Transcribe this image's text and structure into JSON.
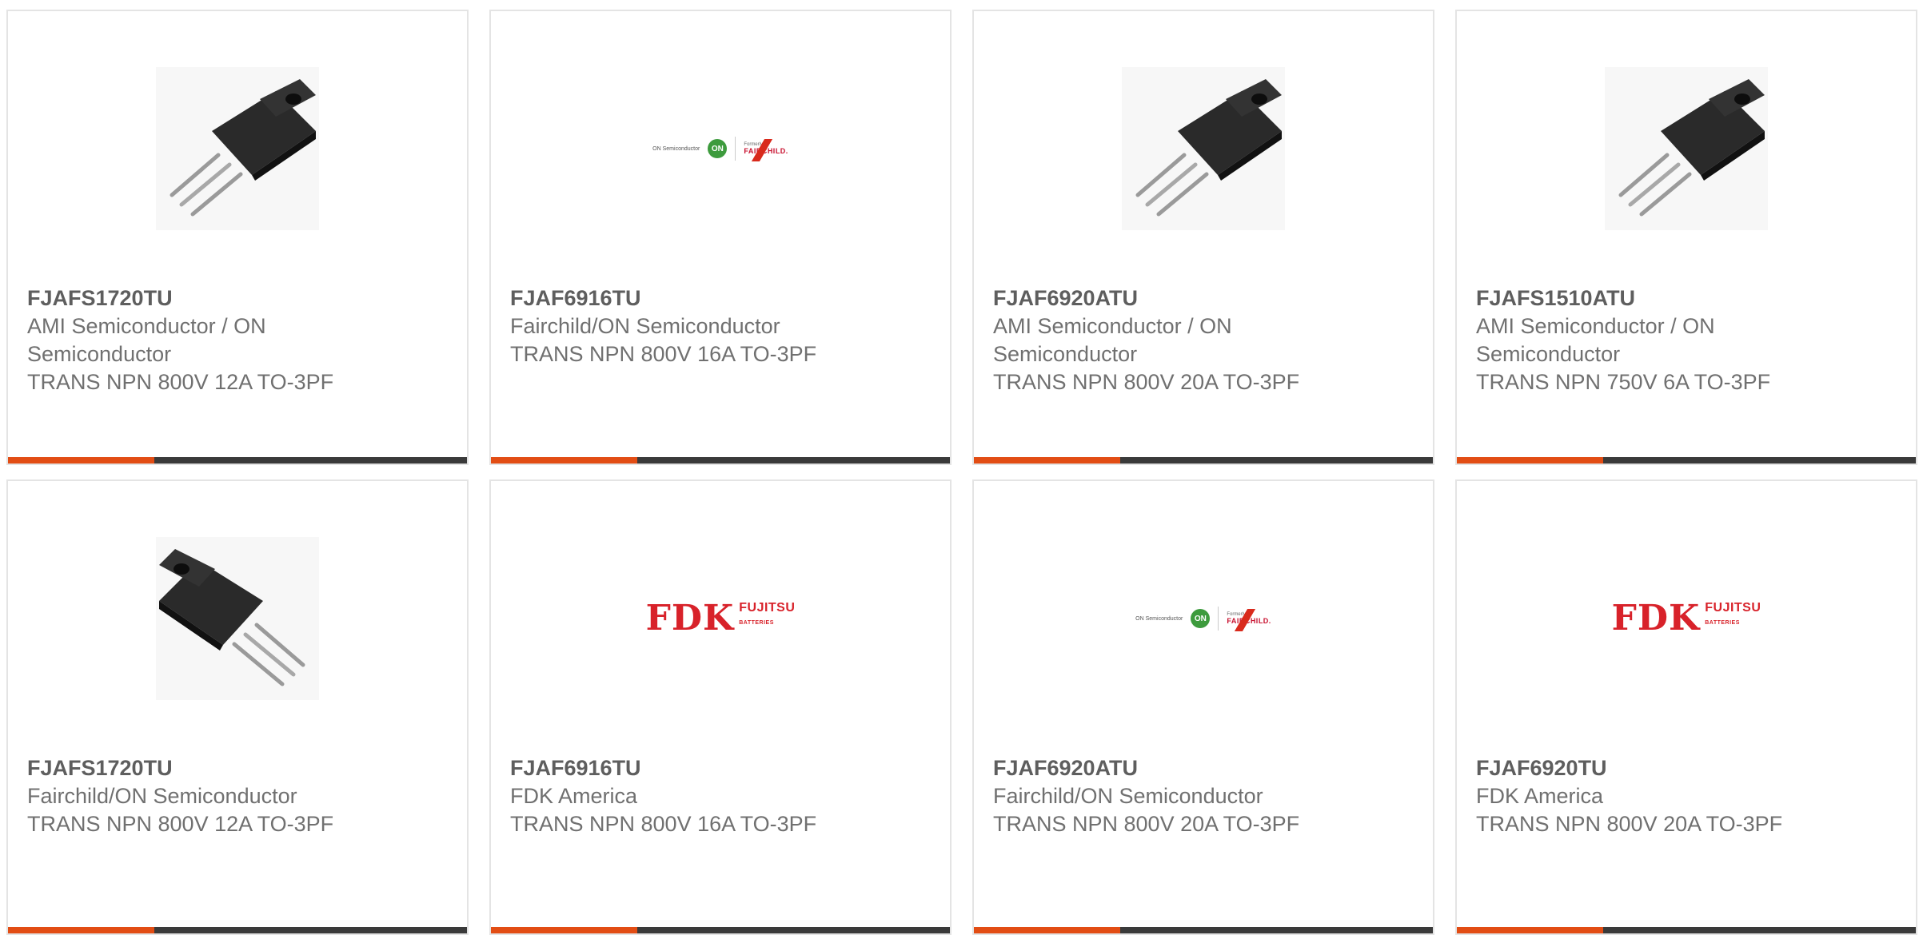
{
  "products": [
    {
      "part": "FJAFS1720TU",
      "manufacturer_lines": [
        "AMI Semiconductor / ON",
        "Semiconductor"
      ],
      "description": "TRANS NPN 800V 12A TO-3PF",
      "image": "transistor-photo"
    },
    {
      "part": "FJAF6916TU",
      "manufacturer_lines": [
        "Fairchild/ON Semiconductor"
      ],
      "description": "TRANS NPN 800V 16A TO-3PF",
      "image": "on-fairchild-logo"
    },
    {
      "part": "FJAF6920ATU",
      "manufacturer_lines": [
        "AMI Semiconductor / ON",
        "Semiconductor"
      ],
      "description": "TRANS NPN 800V 20A TO-3PF",
      "image": "transistor-photo"
    },
    {
      "part": "FJAFS1510ATU",
      "manufacturer_lines": [
        "AMI Semiconductor / ON",
        "Semiconductor"
      ],
      "description": "TRANS NPN 750V 6A TO-3PF",
      "image": "transistor-photo"
    },
    {
      "part": "FJAFS1720TU",
      "manufacturer_lines": [
        "Fairchild/ON Semiconductor"
      ],
      "description": "TRANS NPN 800V 12A TO-3PF",
      "image": "transistor-photo-flipped"
    },
    {
      "part": "FJAF6916TU",
      "manufacturer_lines": [
        "FDK America"
      ],
      "description": "TRANS NPN 800V 16A TO-3PF",
      "image": "fdk-fujitsu-logo"
    },
    {
      "part": "FJAF6920ATU",
      "manufacturer_lines": [
        "Fairchild/ON Semiconductor"
      ],
      "description": "TRANS NPN 800V 20A TO-3PF",
      "image": "on-fairchild-logo"
    },
    {
      "part": "FJAF6920TU",
      "manufacturer_lines": [
        "FDK America"
      ],
      "description": "TRANS NPN 800V 20A TO-3PF",
      "image": "fdk-fujitsu-logo"
    }
  ],
  "logos": {
    "on_semi_text": "ON Semiconductor",
    "on_badge": "ON",
    "formerly": "Formerly",
    "fairchild": "FAIRCHILD.",
    "fdk": "FDK",
    "fujitsu": "FUJITSU",
    "batteries": "BATTERIES"
  },
  "colors": {
    "accent": "#e24d14",
    "bar": "#3a3a3a",
    "fdk_red": "#d8222a",
    "on_green": "#3d9b3d"
  }
}
